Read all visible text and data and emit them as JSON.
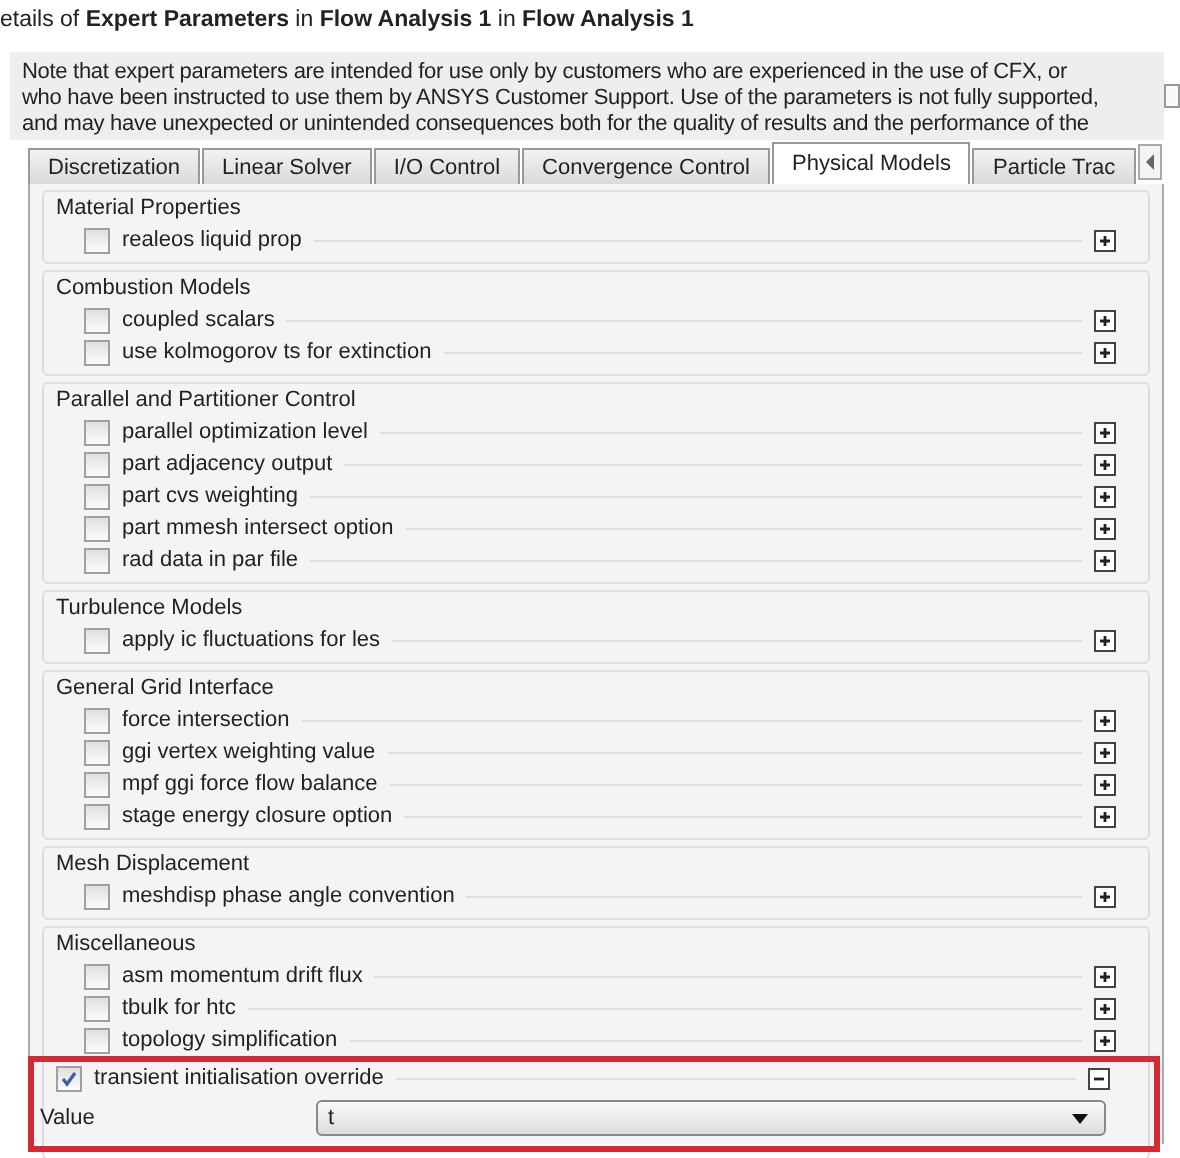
{
  "header": {
    "title": "etails of **Expert Parameters** in **Flow Analysis 1** in **Flow Analysis 1**"
  },
  "note": {
    "lines": [
      "Note that expert parameters are intended for use only by customers who are experienced in the use of CFX, or",
      "who have been instructed to use them by ANSYS Customer Support. Use of the parameters is not fully supported,",
      "and may have unexpected or unintended consequences both for the quality of results and the performance of the"
    ]
  },
  "tabs": [
    {
      "label": "Discretization",
      "selected": false
    },
    {
      "label": "Linear Solver",
      "selected": false
    },
    {
      "label": "I/O Control",
      "selected": false
    },
    {
      "label": "Convergence Control",
      "selected": false
    },
    {
      "label": "Physical Models",
      "selected": true
    },
    {
      "label": "Particle Trac",
      "selected": false
    }
  ],
  "groups": [
    {
      "title": "Material Properties",
      "items": [
        {
          "label": "realeos liquid prop",
          "checked": false,
          "expanded": false
        }
      ]
    },
    {
      "title": "Combustion Models",
      "items": [
        {
          "label": "coupled scalars",
          "checked": false,
          "expanded": false
        },
        {
          "label": "use kolmogorov ts for extinction",
          "checked": false,
          "expanded": false
        }
      ]
    },
    {
      "title": "Parallel and Partitioner Control",
      "items": [
        {
          "label": "parallel optimization level",
          "checked": false,
          "expanded": false
        },
        {
          "label": "part adjacency output",
          "checked": false,
          "expanded": false
        },
        {
          "label": "part cvs weighting",
          "checked": false,
          "expanded": false
        },
        {
          "label": "part mmesh intersect option",
          "checked": false,
          "expanded": false
        },
        {
          "label": "rad data in par file",
          "checked": false,
          "expanded": false
        }
      ]
    },
    {
      "title": "Turbulence Models",
      "items": [
        {
          "label": "apply ic fluctuations for les",
          "checked": false,
          "expanded": false
        }
      ]
    },
    {
      "title": "General Grid Interface",
      "items": [
        {
          "label": "force intersection",
          "checked": false,
          "expanded": false
        },
        {
          "label": "ggi vertex weighting value",
          "checked": false,
          "expanded": false
        },
        {
          "label": "mpf ggi force flow balance",
          "checked": false,
          "expanded": false
        },
        {
          "label": "stage energy closure option",
          "checked": false,
          "expanded": false
        }
      ]
    },
    {
      "title": "Mesh Displacement",
      "items": [
        {
          "label": "meshdisp phase angle convention",
          "checked": false,
          "expanded": false
        }
      ]
    },
    {
      "title": "Miscellaneous",
      "items": [
        {
          "label": "asm momentum drift flux",
          "checked": false,
          "expanded": false
        },
        {
          "label": "tbulk for htc",
          "checked": false,
          "expanded": false
        },
        {
          "label": "topology simplification",
          "checked": false,
          "expanded": false
        },
        {
          "label": "transient initialisation override",
          "checked": true,
          "expanded": true,
          "highlighted": true,
          "value_label": "Value",
          "value": "t"
        }
      ]
    }
  ]
}
